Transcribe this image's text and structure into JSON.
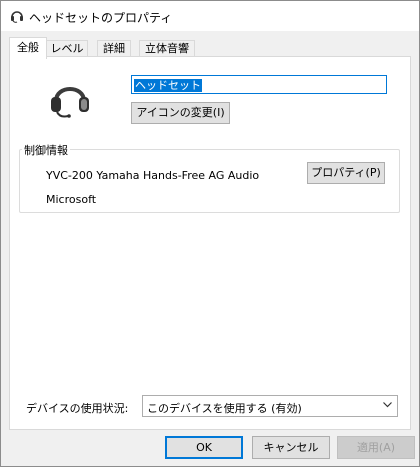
{
  "window": {
    "title": "ヘッドセットのプロパティ"
  },
  "tabs": [
    {
      "label": "全般",
      "active": true
    },
    {
      "label": "レベル",
      "active": false
    },
    {
      "label": "詳細",
      "active": false
    },
    {
      "label": "立体音響",
      "active": false
    }
  ],
  "general": {
    "device_name_value": "ヘッドセット",
    "change_icon_label": "アイコンの変更(I)",
    "controller_group_label": "制御情報",
    "controller_name": "YVC-200 Yamaha Hands-Free AG Audio",
    "properties_label": "プロパティ(P)",
    "manufacturer": "Microsoft",
    "usage_label": "デバイスの使用状況:",
    "usage_selected": "このデバイスを使用する (有効)"
  },
  "footer": {
    "ok_label": "OK",
    "cancel_label": "キャンセル",
    "apply_label": "適用(A)"
  },
  "icons": {
    "title": "headset-icon",
    "device": "headset-icon",
    "select": "chevron-down-icon"
  },
  "colors": {
    "accent": "#0078d7",
    "window_bg": "#f0f0f0",
    "panel_bg": "#ffffff",
    "button_bg": "#e1e1e1"
  }
}
